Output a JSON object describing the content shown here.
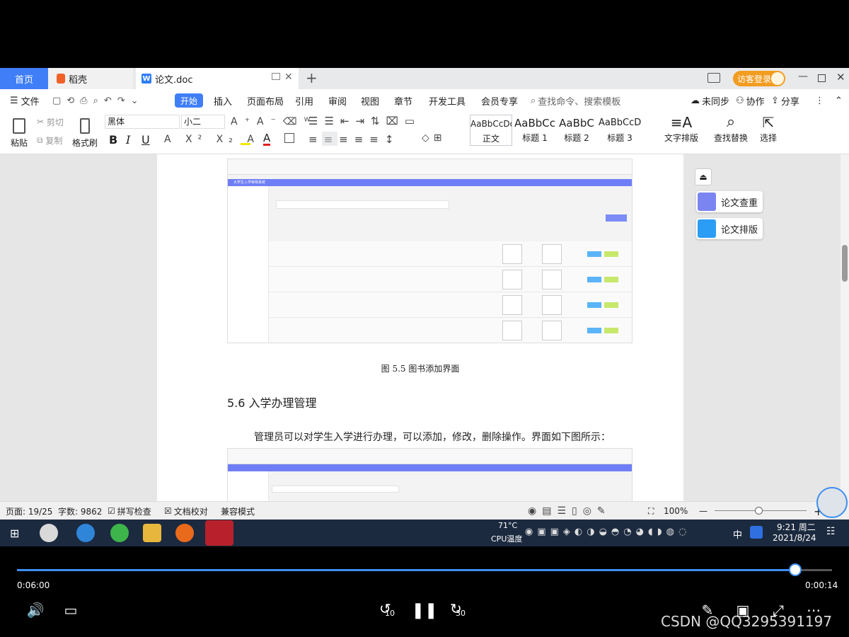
{
  "tabs": {
    "home": "首页",
    "daoke": "稻壳",
    "doc": "论文.doc",
    "new_tab": "+",
    "login": "访客登录"
  },
  "menu": {
    "file": "文件",
    "start": "开始",
    "insert": "插入",
    "layout": "页面布局",
    "reference": "引用",
    "review": "审阅",
    "view": "视图",
    "section": "章节",
    "devtools": "开发工具",
    "member": "会员专享",
    "search": "查找命令、搜索模板",
    "sync": "未同步",
    "collab": "协作",
    "share": "分享"
  },
  "ribbon": {
    "paste": "粘贴",
    "cut": "剪切",
    "copy": "复制",
    "format_painter": "格式刷",
    "font_name": "黑体",
    "font_size": "小二",
    "bold": "B",
    "italic": "I",
    "underline": "U",
    "styles": [
      {
        "preview": "AaBbCcDd",
        "name": "正文"
      },
      {
        "preview": "AaBbCc",
        "name": "标题 1"
      },
      {
        "preview": "AaBbC",
        "name": "标题 2"
      },
      {
        "preview": "AaBbCcD",
        "name": "标题 3"
      }
    ],
    "text_layout": "文字排版",
    "find_replace": "查找替换",
    "select": "选择"
  },
  "document": {
    "figure_caption": "图 5.5  图书添加界面",
    "section_heading": "5.6  入学办理管理",
    "paragraph": "管理员可以对学生入学进行办理，可以添加，修改，删除操作。界面如下图所示：",
    "embedded_app_title": "大学生入学审核系统"
  },
  "side_panel": {
    "check": "论文查重",
    "format": "论文排版"
  },
  "status": {
    "page": "页面: 19/25",
    "words": "字数: 9862",
    "spell": "拼写检查",
    "proof": "文档校对",
    "compat": "兼容模式",
    "zoom": "100%"
  },
  "taskbar": {
    "temp": "71°C",
    "cpu": "CPU温度",
    "ime": "中",
    "time": "9:21 周二",
    "date": "2021/8/24"
  },
  "player": {
    "elapsed": "0:06:00",
    "remaining": "0:00:14",
    "progress": 0.955,
    "rewind_label": "10",
    "forward_label": "30"
  },
  "watermark": "CSDN @QQ3295391197",
  "colors": {
    "accent": "#3f7ef7",
    "player_progress": "#3d8ef0"
  }
}
